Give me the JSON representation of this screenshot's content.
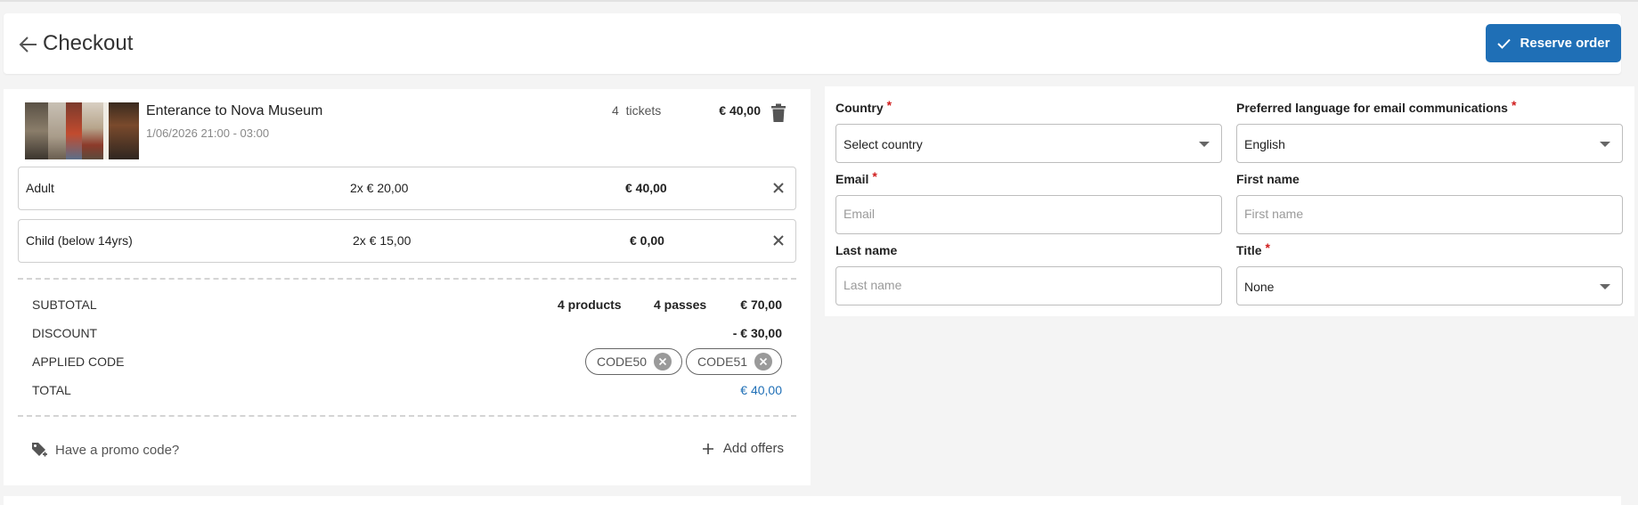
{
  "header": {
    "title": "Checkout",
    "back_icon": "arrow-left-icon",
    "reserve_label": "Reserve order",
    "reserve_icon": "check-icon"
  },
  "product": {
    "title": "Enterance to Nova Museum",
    "date": "1/06/2026 21:00 - 03:00",
    "tickets_count": "4",
    "tickets_label": "tickets",
    "price": "€ 40,00",
    "delete_icon": "trash-icon"
  },
  "tickets": [
    {
      "name": "Adult",
      "qty": "2x € 20,00",
      "amount": "€ 40,00"
    },
    {
      "name": "Child (below 14yrs)",
      "qty": "2x € 15,00",
      "amount": "€ 0,00"
    }
  ],
  "summary": {
    "subtotal_label": "SUBTOTAL",
    "products": "4 products",
    "passes": "4 passes",
    "subtotal": "€ 70,00",
    "discount_label": "DISCOUNT",
    "discount": "- € 30,00",
    "applied_code_label": "APPLIED CODE",
    "codes": [
      "CODE50",
      "CODE51"
    ],
    "total_label": "TOTAL",
    "total": "€ 40,00"
  },
  "links": {
    "promo": "Have a promo code?",
    "promo_icon": "tag-plus-icon",
    "offers": "Add offers",
    "offers_icon": "plus-icon"
  },
  "form": {
    "country": {
      "label": "Country",
      "value": "Select country",
      "required": true
    },
    "language": {
      "label": "Preferred language for email communications",
      "value": "English",
      "required": true
    },
    "email": {
      "label": "Email",
      "placeholder": "Email",
      "required": true
    },
    "first_name": {
      "label": "First name",
      "placeholder": "First name",
      "required": false
    },
    "last_name": {
      "label": "Last name",
      "placeholder": "Last name",
      "required": false
    },
    "title": {
      "label": "Title",
      "value": "None",
      "required": true
    },
    "required_mark": "*"
  },
  "colors": {
    "accent": "#1f6fb6",
    "required": "#d01c1c",
    "total": "#1f6fb6"
  }
}
